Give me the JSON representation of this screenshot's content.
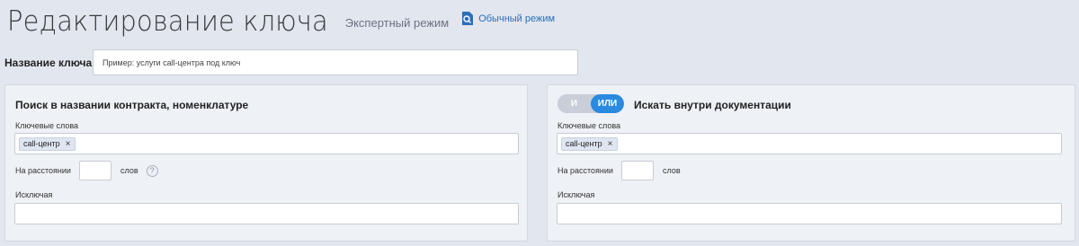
{
  "header": {
    "title": "Редактирование ключа",
    "expert_mode": "Экспертный режим",
    "simple_mode": "Обычный режим"
  },
  "key_name": {
    "label": "Название ключа",
    "placeholder": "Пример: услуги call-центра под ключ"
  },
  "left_panel": {
    "title": "Поиск в названии контракта, номенклатуре",
    "keywords_label": "Ключевые слова",
    "tags": [
      "call-центр"
    ],
    "distance_label": "На расстоянии",
    "words_label": "слов",
    "help": "?",
    "exclude_label": "Исключая"
  },
  "right_panel": {
    "toggle": {
      "and": "И",
      "or": "ИЛИ",
      "selected": "ИЛИ"
    },
    "title": "Искать внутри документации",
    "keywords_label": "Ключевые слова",
    "tags": [
      "call-центр"
    ],
    "distance_label": "На расстоянии",
    "words_label": "слов",
    "exclude_label": "Исключая"
  },
  "icons": {
    "remove_tag": "×",
    "simple_mode_icon": "document-search-icon"
  },
  "colors": {
    "accent": "#2a8ae0",
    "link": "#2d6fb7",
    "background": "#e1e6ef"
  }
}
